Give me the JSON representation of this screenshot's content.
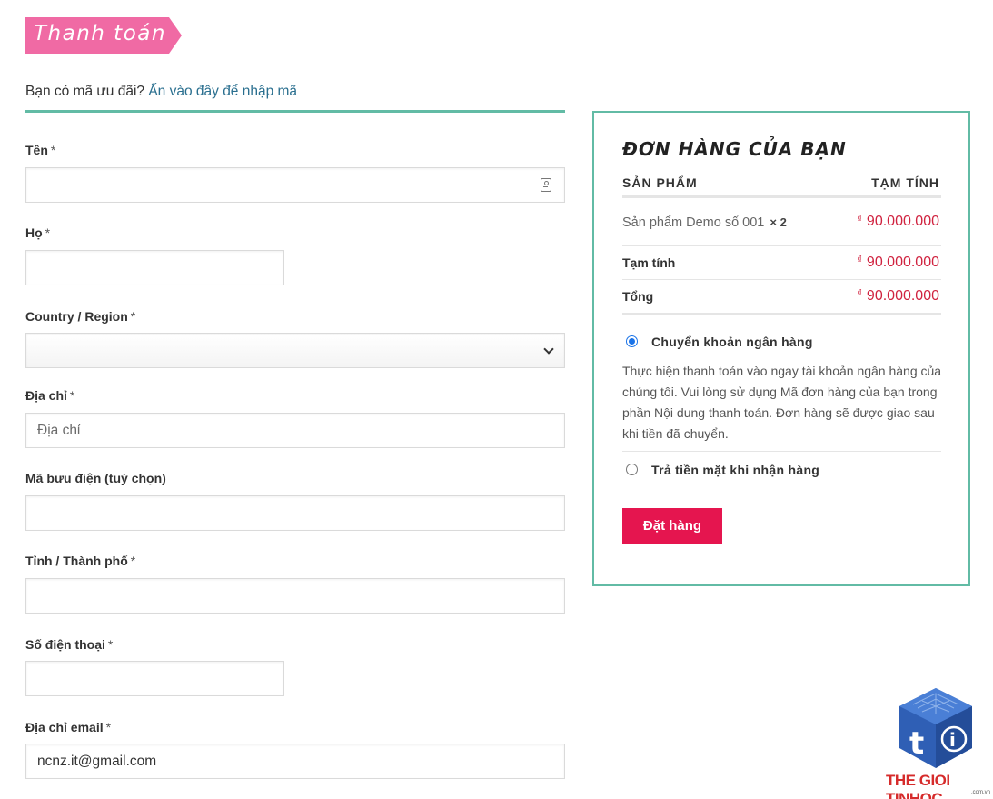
{
  "page_title": "Thanh toán",
  "coupon": {
    "prompt": "Bạn có mã ưu đãi?",
    "link": "Ấn vào đây để nhập mã"
  },
  "form": {
    "first_name": {
      "label": "Tên",
      "required": "*",
      "value": ""
    },
    "last_name": {
      "label": "Họ",
      "required": "*",
      "value": ""
    },
    "country": {
      "label": "Country / Region",
      "required": "*",
      "value": ""
    },
    "address": {
      "label": "Địa chỉ",
      "required": "*",
      "placeholder": "Địa chỉ",
      "value": ""
    },
    "postcode": {
      "label": "Mã bưu điện (tuỳ chọn)",
      "value": ""
    },
    "city": {
      "label": "Tỉnh / Thành phố",
      "required": "*",
      "value": ""
    },
    "phone": {
      "label": "Số điện thoại",
      "required": "*",
      "value": ""
    },
    "email": {
      "label": "Địa chỉ email",
      "required": "*",
      "value": "ncnz.it@gmail.com"
    }
  },
  "order": {
    "title": "ĐƠN HÀNG CỦA BẠN",
    "col_product": "SẢN PHẨM",
    "col_subtotal": "TẠM TÍNH",
    "items": [
      {
        "name": "Sản phẩm Demo số 001",
        "qty": "× 2",
        "currency": "₫",
        "price": "90.000.000"
      }
    ],
    "subtotal": {
      "label": "Tạm tính",
      "currency": "₫",
      "value": "90.000.000"
    },
    "total": {
      "label": "Tổng",
      "currency": "₫",
      "value": "90.000.000"
    },
    "payment_methods": [
      {
        "label": "Chuyển khoản ngân hàng",
        "selected": true,
        "description": "Thực hiện thanh toán vào ngay tài khoản ngân hàng của chúng tôi. Vui lòng sử dụng Mã đơn hàng của bạn trong phần Nội dung thanh toán. Đơn hàng sẽ được giao sau khi tiền đã chuyển."
      },
      {
        "label": "Trả tiền mặt khi nhận hàng",
        "selected": false
      }
    ],
    "place_order": "Đặt hàng"
  },
  "watermark": {
    "text": "THE GIOI TINHOC",
    "sub": ".com.vn",
    "icon": "tinhoc-cube-logo"
  },
  "colors": {
    "ribbon": "#f06aa4",
    "accent_border": "#62bba5",
    "price": "#d0223f",
    "button": "#e5154f",
    "radio": "#1a73e8"
  }
}
